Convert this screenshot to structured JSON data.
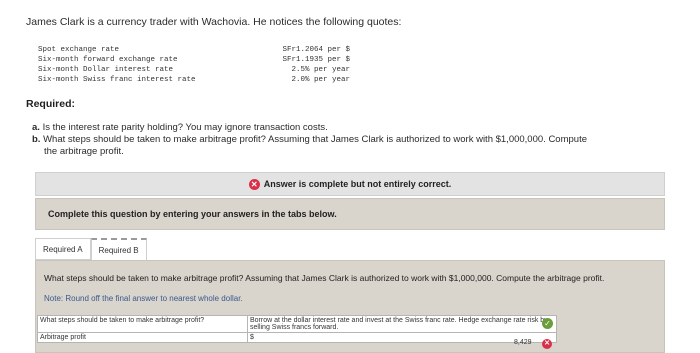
{
  "intro": "James Clark is a currency trader with Wachovia. He notices the following quotes:",
  "quotes": [
    {
      "label": "Spot exchange rate",
      "value": "SFr1.2064 per $"
    },
    {
      "label": "Six-month forward exchange rate",
      "value": "SFr1.1935 per $"
    },
    {
      "label": "Six-month Dollar interest rate",
      "value": "2.5% per year"
    },
    {
      "label": "Six-month Swiss franc interest rate",
      "value": "2.0% per year"
    }
  ],
  "required_title": "Required:",
  "questions": {
    "a_letter": "a.",
    "a_text": "Is the interest rate parity holding? You may ignore transaction costs.",
    "b_letter": "b.",
    "b_text": "What steps should be taken to make arbitrage profit? Assuming that James Clark is authorized to work with $1,000,000. Compute",
    "b_cont": "the arbitrage profit."
  },
  "status": {
    "text": "Answer is complete but not entirely correct."
  },
  "instruction": "Complete this question by entering your answers in the tabs below.",
  "tabs": [
    "Required A",
    "Required B"
  ],
  "panel": {
    "question": "What steps should be taken to make arbitrage profit? Assuming that James Clark is authorized to work with $1,000,000. Compute the arbitrage profit.",
    "note": "Note: Round off the final answer to nearest whole dollar."
  },
  "answers": {
    "row1_label": "What steps should be taken to make arbitrage profit?",
    "row1_value": "Borrow at the dollar interest rate and invest at the Swiss franc rate. Hedge exchange rate risk by selling Swiss francs forward.",
    "row2_label": "Arbitrage profit",
    "row2_currency": "$",
    "row2_value": "8,429"
  },
  "colors": {
    "error": "#d9304a",
    "correct": "#6a9e3a",
    "panel": "#d9d4cc"
  }
}
